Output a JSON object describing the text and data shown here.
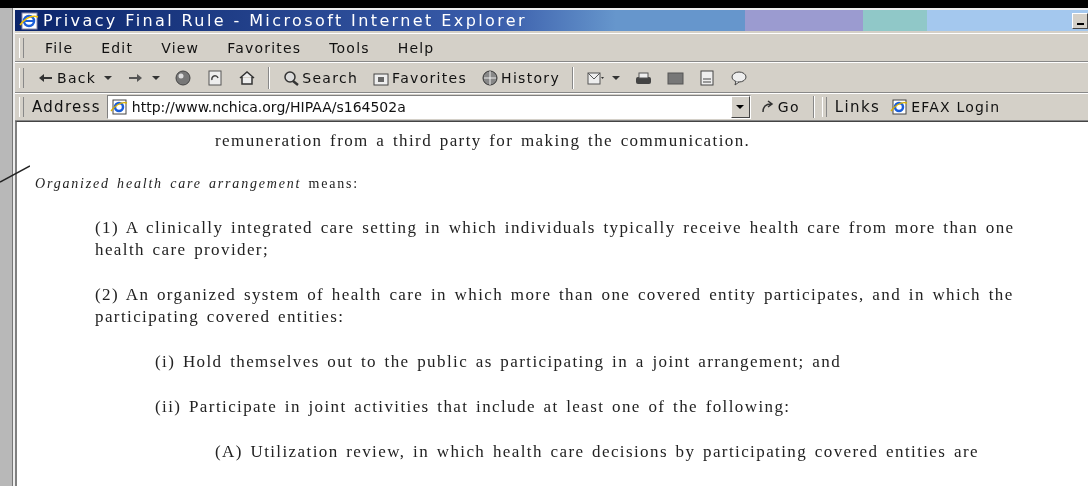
{
  "window": {
    "title": "Privacy Final Rule - Microsoft Internet Explorer"
  },
  "menu": [
    {
      "label": "File"
    },
    {
      "label": "Edit"
    },
    {
      "label": "View"
    },
    {
      "label": "Favorites"
    },
    {
      "label": "Tools"
    },
    {
      "label": "Help"
    }
  ],
  "toolbar": [
    {
      "kind": "back",
      "label": "Back"
    },
    {
      "kind": "forward"
    },
    {
      "kind": "stop"
    },
    {
      "kind": "refresh"
    },
    {
      "kind": "home"
    },
    {
      "kind": "search",
      "label": "Search"
    },
    {
      "kind": "favorites",
      "label": "Favorites"
    },
    {
      "kind": "history",
      "label": "History"
    },
    {
      "kind": "mail"
    },
    {
      "kind": "print"
    },
    {
      "kind": "edit"
    },
    {
      "kind": "page"
    },
    {
      "kind": "discuss"
    }
  ],
  "address_bar": {
    "label": "Address",
    "value": "http://www.nchica.org/HIPAA/s164502a",
    "go": "Go"
  },
  "links": {
    "label": "Links",
    "items": [
      {
        "label": "EFAX Login"
      }
    ]
  },
  "document": {
    "continuation": "remuneration from a third party for making the communication.",
    "definition": "*Organized health care arrangement* means:",
    "items": [
      {
        "text": "(1) A clinically integrated care setting in which individuals typically receive health care from more than one health care provider;"
      },
      {
        "text": "(2) An organized system of health care in which more than one covered entity participates, and in which the participating covered entities:",
        "children": [
          {
            "text": "(i) Hold themselves out to the public as participating in a joint arrangement; and"
          },
          {
            "text": "(ii) Participate in joint activities that include at least one of the following:",
            "children": [
              {
                "text": "(A) Utilization review, in which health care decisions by participating covered entities are"
              }
            ]
          }
        ]
      }
    ]
  }
}
